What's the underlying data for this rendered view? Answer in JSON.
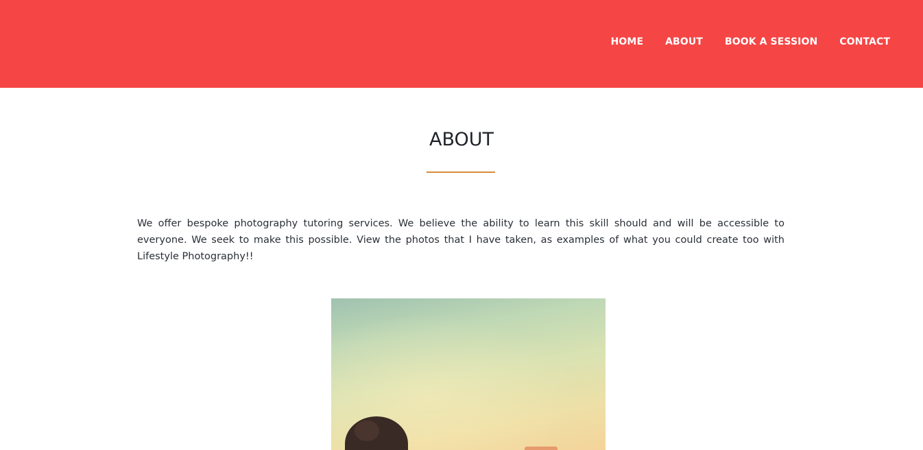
{
  "header": {
    "nav": {
      "home": "HOME",
      "about": "ABOUT",
      "book": "BOOK A SESSION",
      "contact": "CONTACT"
    }
  },
  "main": {
    "title": "ABOUT",
    "description": "We offer bespoke photography tutoring services. We believe the ability to learn this skill should and will be accessible to everyone. We seek to make this possible. View the photos that I have taken, as examples of what you could create too with Lifestyle Photography!!"
  },
  "colors": {
    "header_bg": "#f54545",
    "accent_divider": "#d98a3a",
    "title_text": "#1f2329"
  }
}
